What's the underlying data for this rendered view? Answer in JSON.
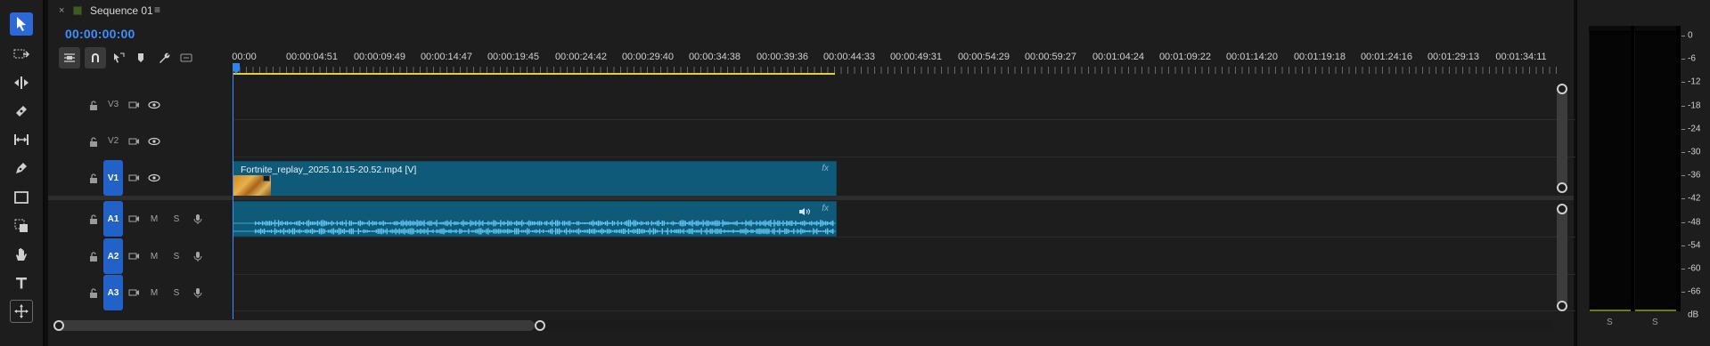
{
  "tools": [
    {
      "name": "selection-tool-icon",
      "active": true
    },
    {
      "name": "track-select-forward-icon"
    },
    {
      "name": "ripple-edit-icon"
    },
    {
      "name": "razor-icon"
    },
    {
      "name": "slip-icon"
    },
    {
      "name": "pen-icon"
    },
    {
      "name": "rectangle-icon"
    },
    {
      "name": "extract-icon"
    },
    {
      "name": "hand-icon"
    },
    {
      "name": "type-icon"
    },
    {
      "name": "move-target-icon"
    }
  ],
  "sequence": {
    "tab_close": "×",
    "name": "Sequence 01",
    "menu": "≡",
    "timecode": "00:00:00:00"
  },
  "ruler": {
    "labels": [
      "00:00",
      "00:00:04:51",
      "00:00:09:49",
      "00:00:14:47",
      "00:00:19:45",
      "00:00:24:42",
      "00:00:29:40",
      "00:00:34:38",
      "00:00:39:36",
      "00:00:44:33",
      "00:00:49:31",
      "00:00:54:29",
      "00:00:59:27",
      "00:01:04:24",
      "00:01:09:22",
      "00:01:14:20",
      "00:01:19:18",
      "00:01:24:16",
      "00:01:29:13",
      "00:01:34:11"
    ]
  },
  "tracks": {
    "v3": "V3",
    "v2": "V2",
    "v1": "V1",
    "a1": "A1",
    "a2": "A2",
    "a3": "A3",
    "mute": "M",
    "solo": "S"
  },
  "clips": {
    "video_title": "Fortnite_replay_2025.10.15-20.52.mp4 [V]",
    "fx": "fx"
  },
  "meters": {
    "db_labels": [
      "0",
      "-6",
      "-12",
      "-18",
      "-24",
      "-30",
      "-36",
      "-42",
      "-48",
      "-54",
      "-60",
      "-66",
      "dB"
    ],
    "solo_left": "S",
    "solo_right": "S"
  },
  "colors": {
    "accent": "#2d68d8",
    "timecode": "#3a90ff",
    "clip": "#0e5a78",
    "work_area": "#e6cf3a"
  }
}
